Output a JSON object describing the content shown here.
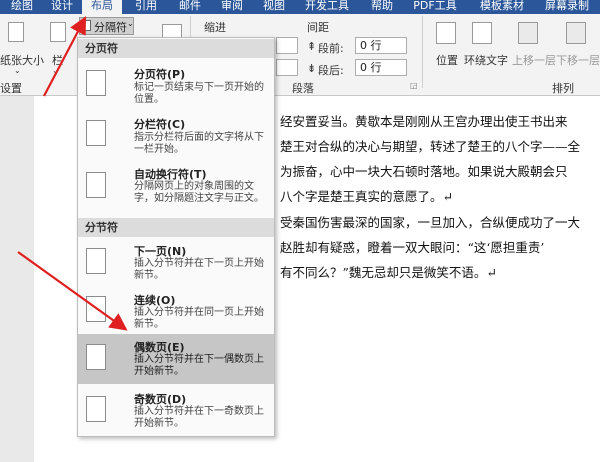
{
  "tabs": [
    "绘图",
    "设计",
    "布局",
    "引用",
    "邮件",
    "审阅",
    "视图",
    "开发工具",
    "帮助",
    "PDF工具",
    "模板素材",
    "屏幕录制"
  ],
  "ribbon": {
    "paper_size": "纸张大小",
    "columns": "栏",
    "breaks_button": "分隔符",
    "group_setup": "设置",
    "indent": "缩进",
    "spacing": "间距",
    "before_label": "段前:",
    "before_value": "0 行",
    "after_label": "段后:",
    "after_value": "0 行",
    "group_paragraph": "段落",
    "position": "位置",
    "wrap_text": "环绕文字",
    "bring_forward": "上移一层",
    "send_backward": "下移一层",
    "group_arrange": "排列"
  },
  "menu": {
    "page_breaks_header": "分页符",
    "section_breaks_header": "分节符",
    "items": [
      {
        "title": "分页符(P)",
        "desc": "标记一页结束与下一页开始的位置。"
      },
      {
        "title": "分栏符(C)",
        "desc": "指示分栏符后面的文字将从下一栏开始。"
      },
      {
        "title": "自动换行符(T)",
        "desc": "分隔网页上的对象周围的文字，如分隔题注文字与正文。"
      },
      {
        "title": "下一页(N)",
        "desc": "插入分节符并在下一页上开始新节。"
      },
      {
        "title": "连续(O)",
        "desc": "插入分节符并在同一页上开始新节。"
      },
      {
        "title": "偶数页(E)",
        "desc": "插入分节符并在下一偶数页上开始新节。"
      },
      {
        "title": "奇数页(D)",
        "desc": "插入分节符并在下一奇数页上开始新节。"
      }
    ]
  },
  "document": {
    "lines": [
      "经安置妥当。黄歇本是刚刚从王宫办理出使王书出来",
      "楚王对合纵的决心与期望，转述了楚王的八个字——全",
      "为振奋，心中一块大石顿时落地。如果说大殿朝会只",
      "八个字是楚王真实的意愿了。↵",
      "受秦国伤害最深的国家，一旦加入，合纵便成功了一大",
      "赵胜却有疑惑，瞪着一双大眼问：“这‘愿担重责’",
      "有不同么？”魏无忌却只是微笑不语。↵"
    ]
  },
  "colors": {
    "accent": "#2b579a",
    "annotation_arrow": "#e02020",
    "highlight": "#c6c6c6"
  }
}
